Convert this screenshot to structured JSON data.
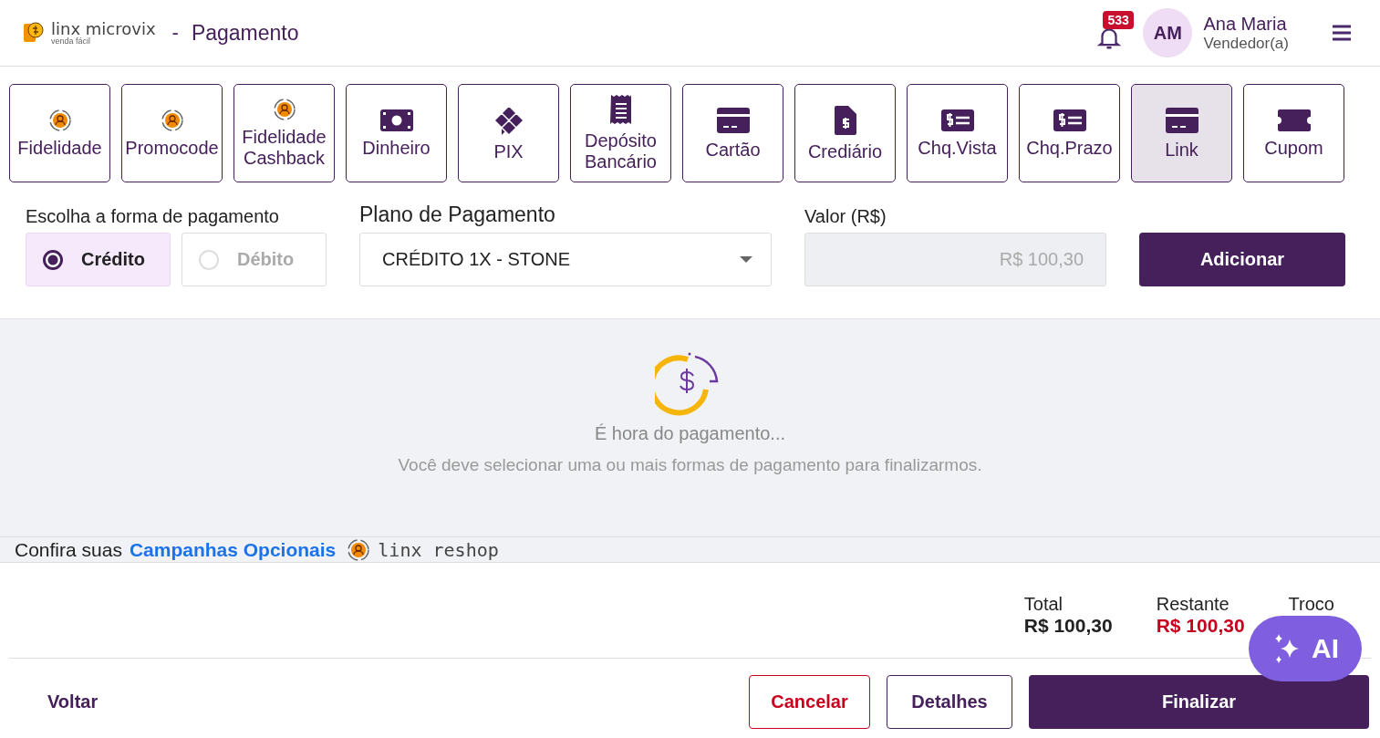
{
  "header": {
    "brand": "linx microvix",
    "brand_sub": "venda fácil",
    "separator": "-",
    "title": "Pagamento",
    "notifications": "533",
    "avatar": "AM",
    "user_name": "Ana Maria",
    "user_role": "Vendedor(a)"
  },
  "methods": [
    {
      "label": "Fidelidade",
      "kind": "loyalty",
      "selected": false
    },
    {
      "label": "Promocode",
      "kind": "loyalty",
      "selected": false
    },
    {
      "label": "Fidelidade Cashback",
      "kind": "loyalty",
      "selected": false
    },
    {
      "label": "Dinheiro",
      "kind": "cash",
      "selected": false
    },
    {
      "label": "PIX",
      "kind": "pix",
      "selected": false
    },
    {
      "label": "Depósito Bancário",
      "kind": "deposit",
      "selected": false
    },
    {
      "label": "Cartão",
      "kind": "card",
      "selected": false
    },
    {
      "label": "Crediário",
      "kind": "credit",
      "selected": false
    },
    {
      "label": "Chq.Vista",
      "kind": "cheque",
      "selected": false
    },
    {
      "label": "Chq.Prazo",
      "kind": "cheque",
      "selected": false
    },
    {
      "label": "Link",
      "kind": "card",
      "selected": true
    },
    {
      "label": "Cupom",
      "kind": "coupon",
      "selected": false
    }
  ],
  "form": {
    "type_label": "Escolha a forma de pagamento",
    "types": [
      {
        "label": "Crédito",
        "selected": true,
        "disabled": false
      },
      {
        "label": "Débito",
        "selected": false,
        "disabled": true
      }
    ],
    "plan_label": "Plano de Pagamento",
    "plan_value": "CRÉDITO 1X - STONE",
    "value_label": "Valor (R$)",
    "value_placeholder": "R$ 100,30",
    "add_button": "Adicionar"
  },
  "empty": {
    "title": "É hora do pagamento...",
    "message": "Você deve selecionar uma ou mais formas de pagamento para finalizarmos."
  },
  "campaign": {
    "text": "Confira suas",
    "link": "Campanhas Opcionais",
    "brand": "linx reshop"
  },
  "totals": [
    {
      "label": "Total",
      "value": "R$ 100,30",
      "kind": "normal"
    },
    {
      "label": "Restante",
      "value": "R$ 100,30",
      "kind": "alert"
    },
    {
      "label": "Troco"
    }
  ],
  "ai_button": "AI",
  "footer": {
    "back": "Voltar",
    "cancel": "Cancelar",
    "details": "Detalhes",
    "finish": "Finalizar"
  }
}
